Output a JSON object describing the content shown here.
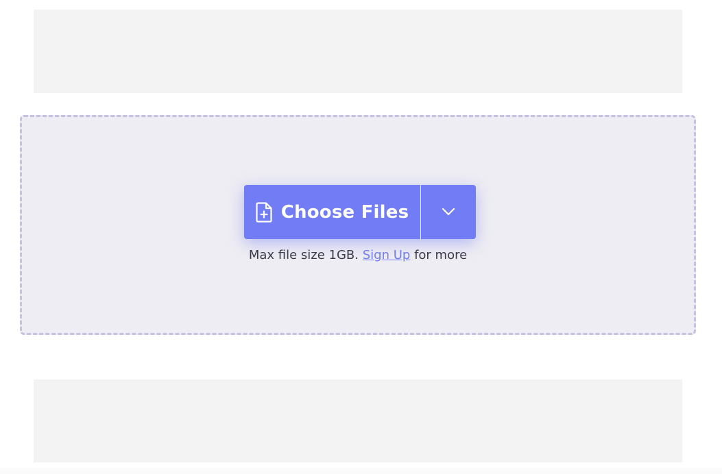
{
  "upload": {
    "choose_files_label": "Choose Files",
    "icon": "file-plus-icon",
    "dropdown_icon": "chevron-down-icon",
    "note_prefix": "Max file size 1GB.",
    "signup_link": "Sign Up",
    "note_suffix": "for more"
  },
  "colors": {
    "accent": "#727cf5",
    "dropzone_bg": "#eeedf3",
    "dropzone_border": "#c5c2e0",
    "ad_bg": "#f3f3f3"
  }
}
